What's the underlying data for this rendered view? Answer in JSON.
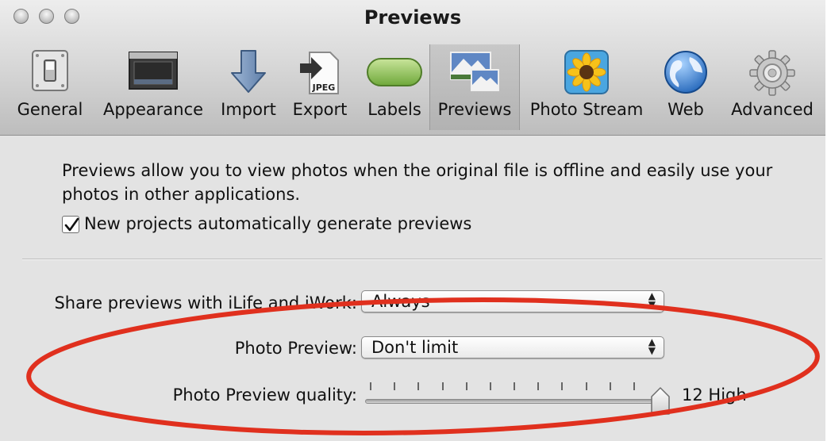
{
  "window": {
    "title": "Previews",
    "traffic_lights": [
      "close",
      "minimize",
      "zoom"
    ]
  },
  "toolbar": {
    "items": [
      {
        "label": "General",
        "icon": "toggle-switch-icon",
        "selected": false
      },
      {
        "label": "Appearance",
        "icon": "window-appearance-icon",
        "selected": false
      },
      {
        "label": "Import",
        "icon": "down-arrow-icon",
        "selected": false
      },
      {
        "label": "Export",
        "icon": "jpeg-export-icon",
        "selected": false
      },
      {
        "label": "Labels",
        "icon": "green-label-icon",
        "selected": false
      },
      {
        "label": "Previews",
        "icon": "mountain-photos-icon",
        "selected": true
      },
      {
        "label": "Photo Stream",
        "icon": "sunflower-icon",
        "selected": false
      },
      {
        "label": "Web",
        "icon": "globe-icon",
        "selected": false
      },
      {
        "label": "Advanced",
        "icon": "gear-icon",
        "selected": false
      }
    ]
  },
  "content": {
    "description": "Previews allow you to view photos when the original file is offline and easily use your photos in other applications.",
    "auto_generate": {
      "label": "New projects automatically generate previews",
      "checked": true
    },
    "share": {
      "label": "Share previews with iLife and iWork:",
      "value": "Always"
    },
    "photo_preview": {
      "label": "Photo Preview:",
      "value": "Don't limit"
    },
    "quality": {
      "label": "Photo Preview quality:",
      "value": "12 High",
      "level": 12,
      "max": 12,
      "ticks": 13
    }
  },
  "colors": {
    "annotation": "#e0301e",
    "selected_toolbar": "#b8b8b8"
  }
}
